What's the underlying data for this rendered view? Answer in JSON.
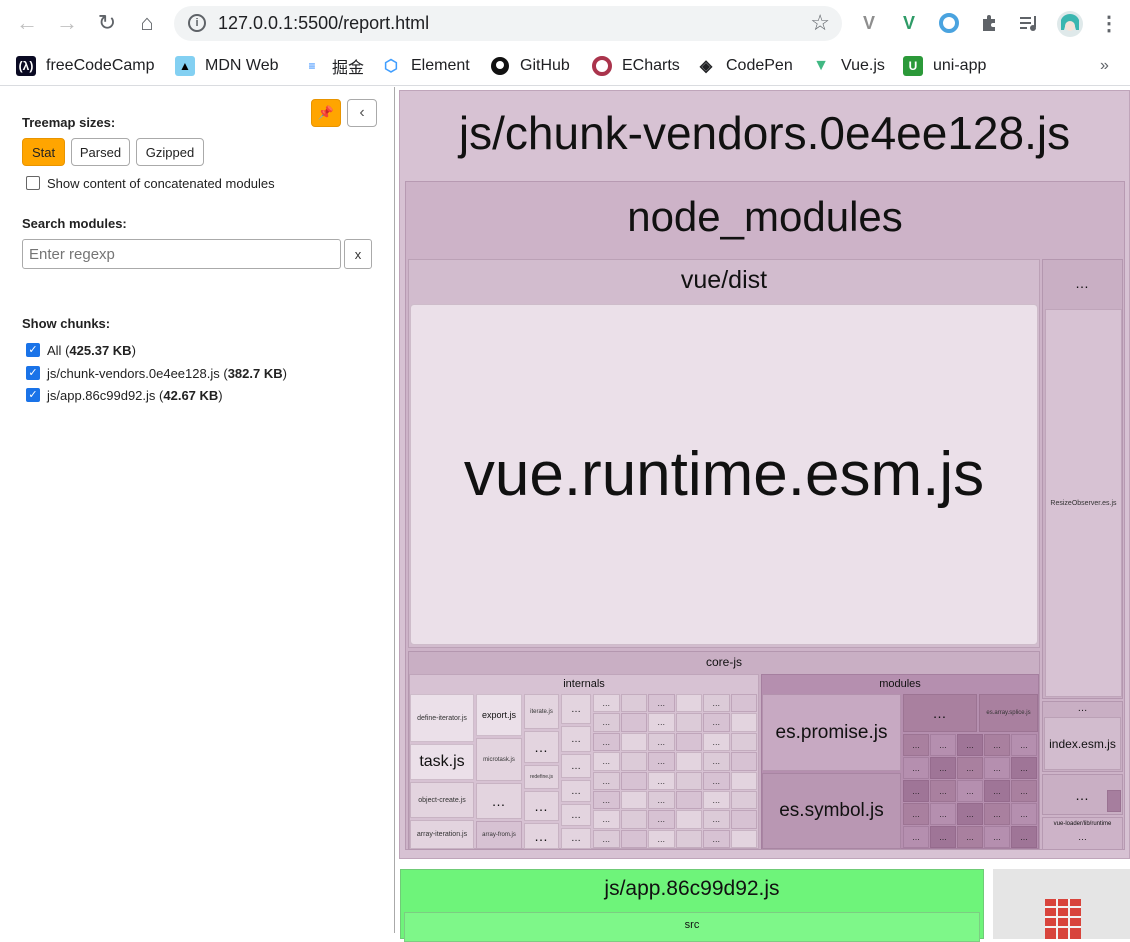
{
  "browser": {
    "url": "127.0.0.1:5500/report.html",
    "bookmarks": [
      "freeCodeCamp",
      "MDN Web",
      "掘金",
      "Element",
      "GitHub",
      "ECharts",
      "CodePen",
      "Vue.js",
      "uni-app"
    ],
    "more": "»"
  },
  "sidebar": {
    "treemap_sizes_label": "Treemap sizes:",
    "size_buttons": [
      "Stat",
      "Parsed",
      "Gzipped"
    ],
    "active_size": "Stat",
    "concat_label": "Show content of concatenated modules",
    "search_label": "Search modules:",
    "search_placeholder": "Enter regexp",
    "clear_label": "x",
    "chunks_label": "Show chunks:",
    "chunks": [
      {
        "name": "All",
        "size": "425.37 KB",
        "checked": true
      },
      {
        "name": "js/chunk-vendors.0e4ee128.js",
        "size": "382.7 KB",
        "checked": true
      },
      {
        "name": "js/app.86c99d92.js",
        "size": "42.67 KB",
        "checked": true
      }
    ]
  },
  "treemap": {
    "vendors_chunk": "js/chunk-vendors.0e4ee128.js",
    "node_modules": "node_modules",
    "vue_dist": "vue/dist",
    "vue_runtime": "vue.runtime.esm.js",
    "core_js": "core-js",
    "internals": "internals",
    "modules": "modules",
    "define_iterator": "define-iterator.js",
    "export_js": "export.js",
    "iterate_js": "iterate.js",
    "task_js": "task.js",
    "microtask_js": "microtask.js",
    "redefine_js": "redefine.js",
    "object_create": "object-create.js",
    "array_iteration": "array-iteration.js",
    "array_from": "array-from.js",
    "es_promise": "es.promise.js",
    "es_symbol": "es.symbol.js",
    "es_array_splice": "es.array.splice.js",
    "resize_observer": "ResizeObserver.es.js",
    "index_esm": "index.esm.js",
    "vue_loader_runtime": "vue-loader/lib/runtime",
    "ellipsis": "…",
    "app_chunk": "js/app.86c99d92.js",
    "src": "src"
  },
  "colors": {
    "vendors": "#d7c2d3",
    "vue_runtime": "#ebe0e9",
    "app": "#6ef47a",
    "active_button": "#ffa500"
  }
}
